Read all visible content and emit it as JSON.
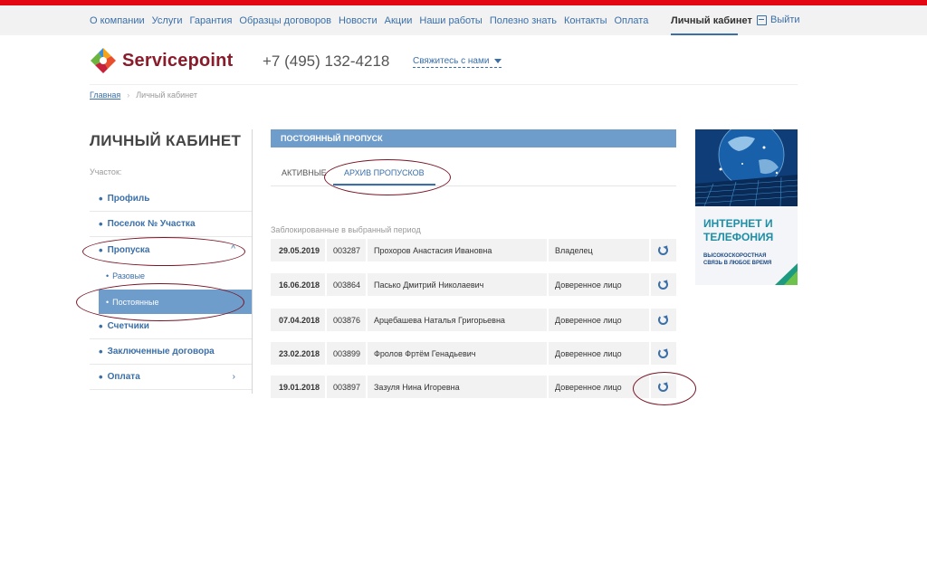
{
  "top_nav": {
    "links": [
      "О компании",
      "Услуги",
      "Гарантия",
      "Образцы договоров",
      "Новости",
      "Акции",
      "Наши работы",
      "Полезно знать",
      "Контакты",
      "Оплата"
    ],
    "cabinet": "Личный кабинет",
    "logout": "Выйти"
  },
  "header": {
    "brand": "Servicepoint",
    "phone": "+7 (495) 132-4218",
    "contact_link": "Свяжитесь с нами"
  },
  "breadcrumb": {
    "home": "Главная",
    "current": "Личный кабинет"
  },
  "sidebar": {
    "title": "ЛИЧНЫЙ КАБИНЕТ",
    "section_label": "Участок:",
    "items": [
      {
        "label": "Профиль"
      },
      {
        "label": "Поселок № Участка"
      },
      {
        "label": "Пропуска",
        "expanded": true
      },
      {
        "label": "Счетчики"
      },
      {
        "label": "Заключенные договора"
      },
      {
        "label": "Оплата"
      }
    ],
    "sub_items": [
      {
        "label": "Разовые"
      },
      {
        "label": "Постоянные",
        "active": true
      }
    ]
  },
  "panel": {
    "header": "ПОСТОЯННЫЙ ПРОПУСК",
    "tabs": [
      {
        "label": "АКТИВНЫЕ"
      },
      {
        "label": "АРХИВ ПРОПУСКОВ",
        "active": true
      }
    ],
    "blocked_label": "Заблокированные в выбранный период",
    "rows": [
      {
        "date": "29.05.2019",
        "number": "003287",
        "name": "Прохоров Анастасия Ивановна",
        "role": "Владелец"
      },
      {
        "date": "16.06.2018",
        "number": "003864",
        "name": "Пасько Дмитрий Николаевич",
        "role": "Доверенное лицо"
      },
      {
        "date": "07.04.2018",
        "number": "003876",
        "name": "Арцебашева Наталья Григорьевна",
        "role": "Доверенное лицо"
      },
      {
        "date": "23.02.2018",
        "number": "003899",
        "name": "Фролов Фртём Генадьевич",
        "role": "Доверенное лицо"
      },
      {
        "date": "19.01.2018",
        "number": "003897",
        "name": "Зазуля Нина Игоревна",
        "role": "Доверенное лицо"
      }
    ]
  },
  "ad": {
    "title": "ИНТЕРНЕТ И ТЕЛЕФОНИЯ",
    "subtitle": "ВЫСОКОСКОРОСТНАЯ СВЯЗЬ В ЛЮБОЕ ВРЕМЯ"
  },
  "colors": {
    "accent": "#3a6fa8",
    "brand": "#8a1b2b",
    "top_bar": "#e30613",
    "active_bg": "#6e9ccb",
    "annotation": "#7a1526"
  }
}
